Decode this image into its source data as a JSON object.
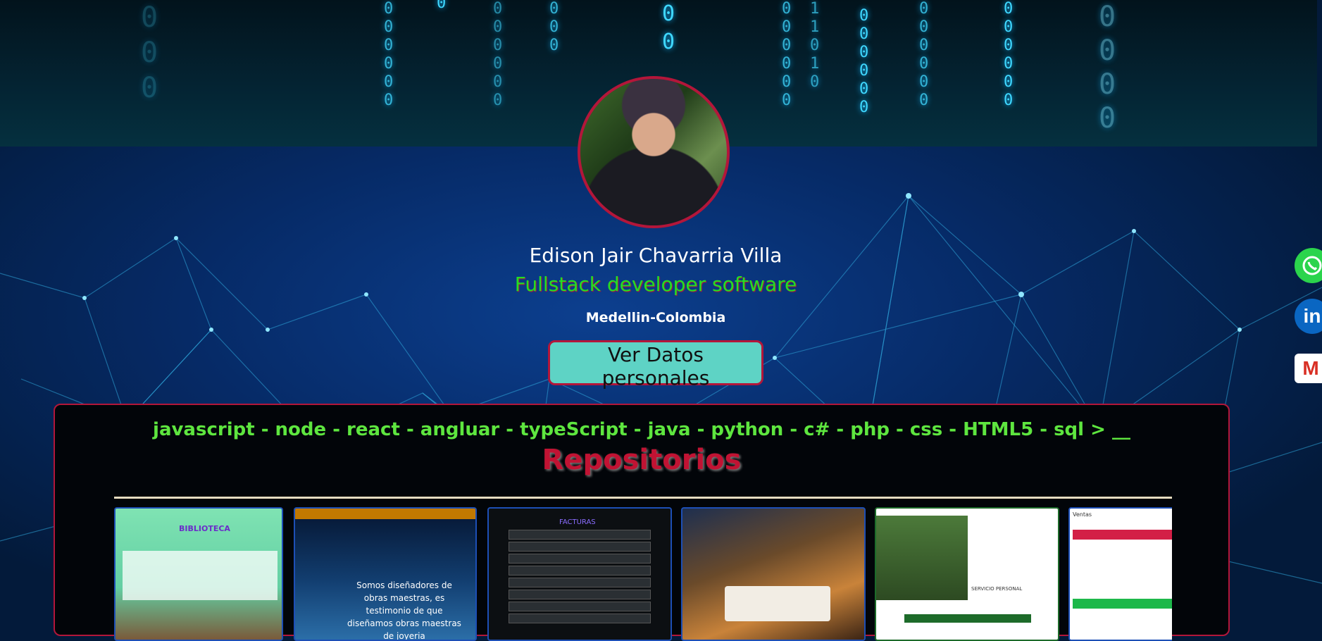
{
  "profile": {
    "name": "Edison Jair Chavarria Villa",
    "role": "Fullstack developer software",
    "location": "Medellin-Colombia",
    "cta_label": "Ver Datos personales"
  },
  "skills_line": "javascript - node - react - angluar - typeScript - java - python - c# - php - css - HTML5 - sql > __",
  "repositories": {
    "title": "Repositorios",
    "items": [
      {
        "label": "BIBLIOTECA"
      },
      {
        "label": "Somos diseñadores de obras maestras, es testimonio de que diseñamos obras maestras de joyeria"
      },
      {
        "label": "FACTURAS"
      },
      {
        "label": ""
      },
      {
        "label": "SERVICIO PERSONAL"
      },
      {
        "label": "Ventas"
      }
    ]
  },
  "social": {
    "icons": [
      "whatsapp-icon",
      "linkedin-icon",
      "gmail-icon"
    ],
    "linkedin_glyph": "in",
    "gmail_glyph": "M"
  },
  "colors": {
    "accent_red": "#b3163a",
    "accent_green": "#22e022",
    "button_teal": "#5ed3c5"
  }
}
